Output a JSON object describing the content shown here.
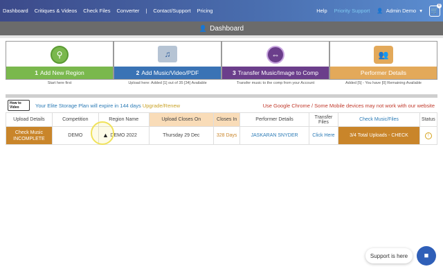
{
  "nav": {
    "left": [
      "Dashboard",
      "Critiques & Videos",
      "Check Files",
      "Converter",
      "|",
      "Contact/Support",
      "Pricing"
    ],
    "help": "Help",
    "priority": "Priority Support",
    "user": "Admin Demo",
    "cart_count": "0"
  },
  "page_title": "Dashboard",
  "cards": [
    {
      "num": "1",
      "label": "Add New Region",
      "sub": "Start here first",
      "icon": "location-pin-icon"
    },
    {
      "num": "2",
      "label": "Add Music/Video/PDF",
      "sub": "Upload here: Added [1] out of 35 [34] Available",
      "icon": "music-folder-icon"
    },
    {
      "num": "3",
      "label": "Transfer Music/Image to Comp",
      "sub": "Transfer music to the comp from your Account",
      "icon": "transfer-arrows-icon"
    },
    {
      "num": "",
      "label": "Performer Details",
      "sub": "Added [5] - You have [0] Remaining Available",
      "icon": "group-icon"
    }
  ],
  "info": {
    "howto_line1": "How to",
    "howto_line2": "Video",
    "plan_text": "Your Elite Storage Plan will expire in 144 days",
    "renew": "Upgrade/Renew",
    "warning": "Use Google Chrome / Some Mobile devices may not work with our website"
  },
  "table": {
    "headers": [
      "Upload Details",
      "Competition",
      "Region Name",
      "Upload Closes On",
      "Closes In",
      "Performer Details",
      "Transfer Files",
      "Check Music/Files",
      "Status"
    ],
    "row": {
      "upload_line1": "Check Music",
      "upload_line2": "INCOMPLETE",
      "competition": "DEMO",
      "region": "DEMO 2022",
      "closes_on": "Thursday 29 Dec",
      "closes_in": "328 Days",
      "performer": "JASKARAN SNYDER",
      "transfer": "Click Here",
      "check": "3/4 Total Uploads - CHECK",
      "status_icon": "!"
    }
  },
  "support": "Support is here"
}
